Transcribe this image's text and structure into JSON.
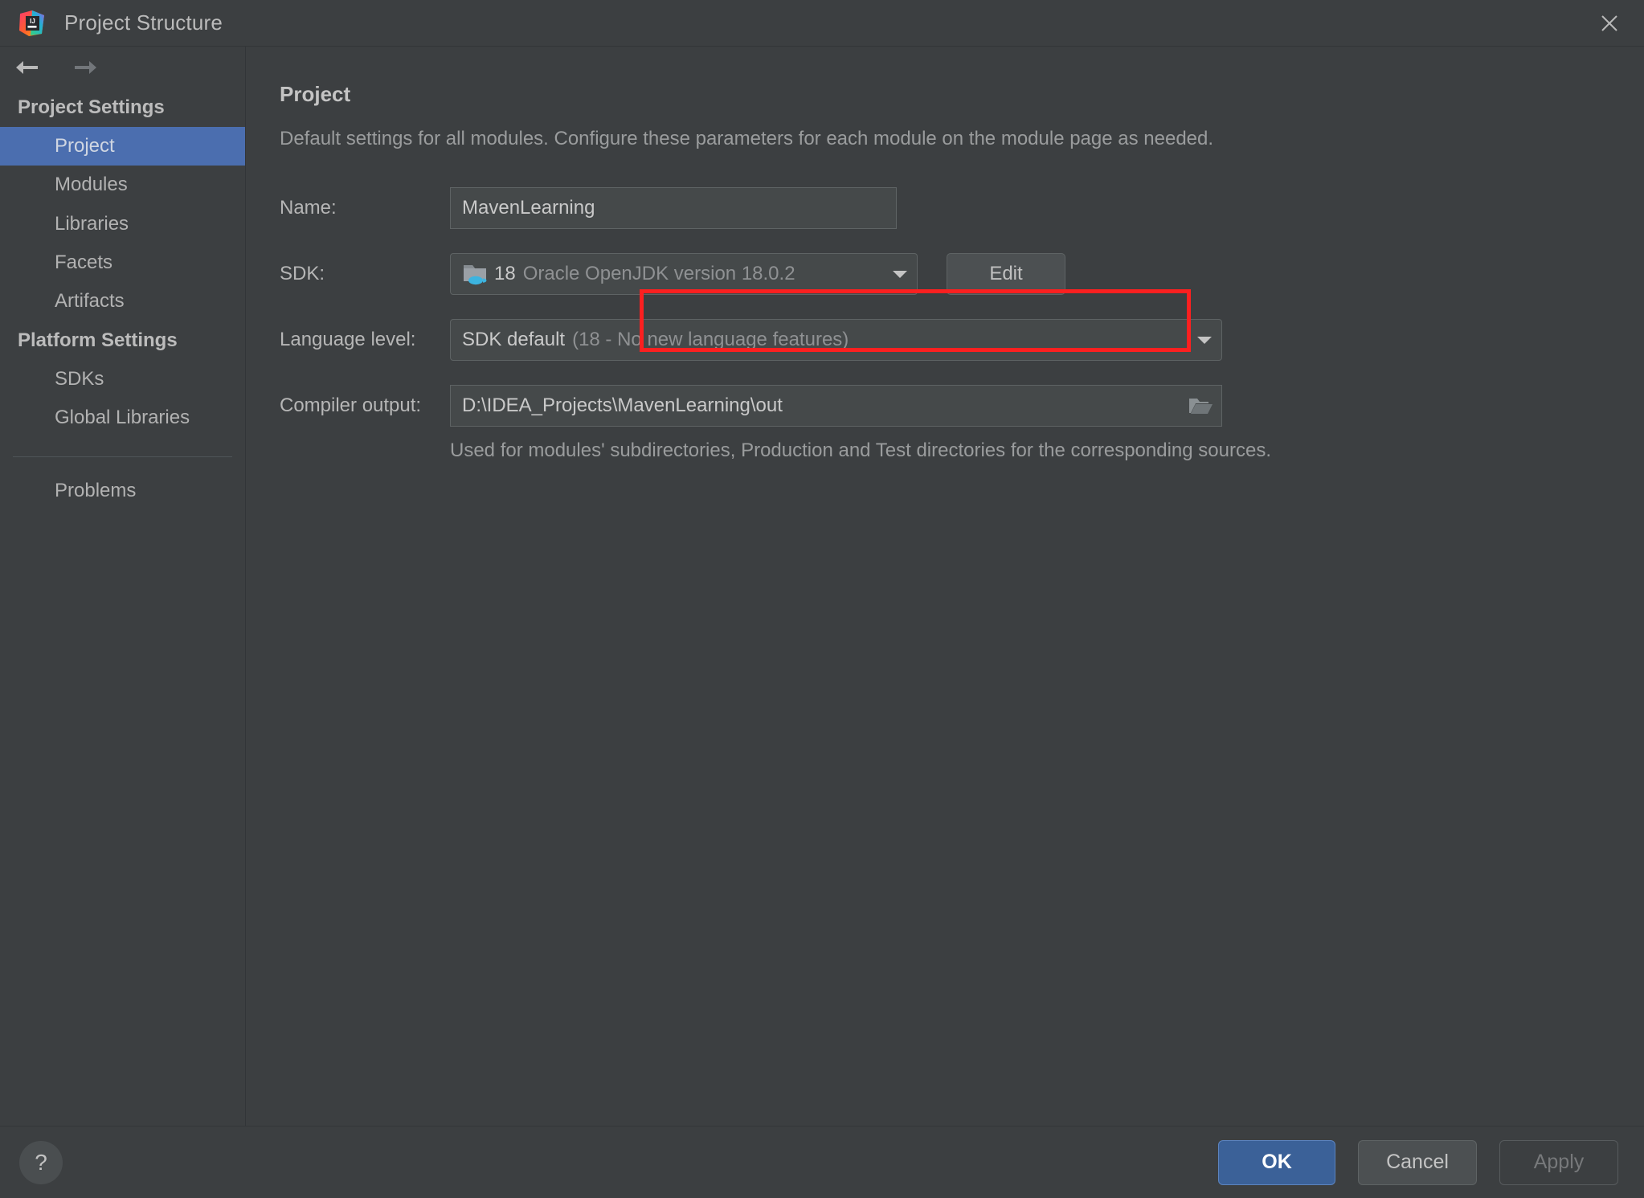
{
  "window": {
    "title": "Project Structure",
    "app_icon": "intellij-idea-icon",
    "close_label": "×"
  },
  "nav": {
    "back_icon": "arrow-left-icon",
    "forward_icon": "arrow-right-icon"
  },
  "sidebar": {
    "groups": [
      {
        "header": "Project Settings",
        "items": [
          {
            "label": "Project",
            "selected": true
          },
          {
            "label": "Modules",
            "selected": false
          },
          {
            "label": "Libraries",
            "selected": false
          },
          {
            "label": "Facets",
            "selected": false
          },
          {
            "label": "Artifacts",
            "selected": false
          }
        ]
      },
      {
        "header": "Platform Settings",
        "items": [
          {
            "label": "SDKs",
            "selected": false
          },
          {
            "label": "Global Libraries",
            "selected": false
          }
        ]
      }
    ],
    "problems_label": "Problems"
  },
  "main": {
    "title": "Project",
    "description": "Default settings for all modules. Configure these parameters for each module on the module page as needed.",
    "name_field": {
      "label": "Name:",
      "value": "MavenLearning",
      "placeholder": ""
    },
    "sdk_field": {
      "label": "SDK:",
      "icon": "jdk-folder-icon",
      "version": "18",
      "detail": "Oracle OpenJDK version 18.0.2",
      "caret_icon": "chevron-down-icon",
      "edit_label": "Edit"
    },
    "language_level_field": {
      "label": "Language level:",
      "primary": "SDK default",
      "detail": "(18 - No new language features)",
      "caret_icon": "chevron-down-icon"
    },
    "compiler_output_field": {
      "label": "Compiler output:",
      "value": "D:\\IDEA_Projects\\MavenLearning\\out",
      "browse_icon": "folder-open-icon",
      "hint": "Used for modules' subdirectories, Production and Test directories for the corresponding sources."
    }
  },
  "annotation": {
    "color": "#fb2020",
    "target": "sdk-combo"
  },
  "footer": {
    "help_label": "?",
    "ok_label": "OK",
    "cancel_label": "Cancel",
    "apply_label": "Apply"
  }
}
